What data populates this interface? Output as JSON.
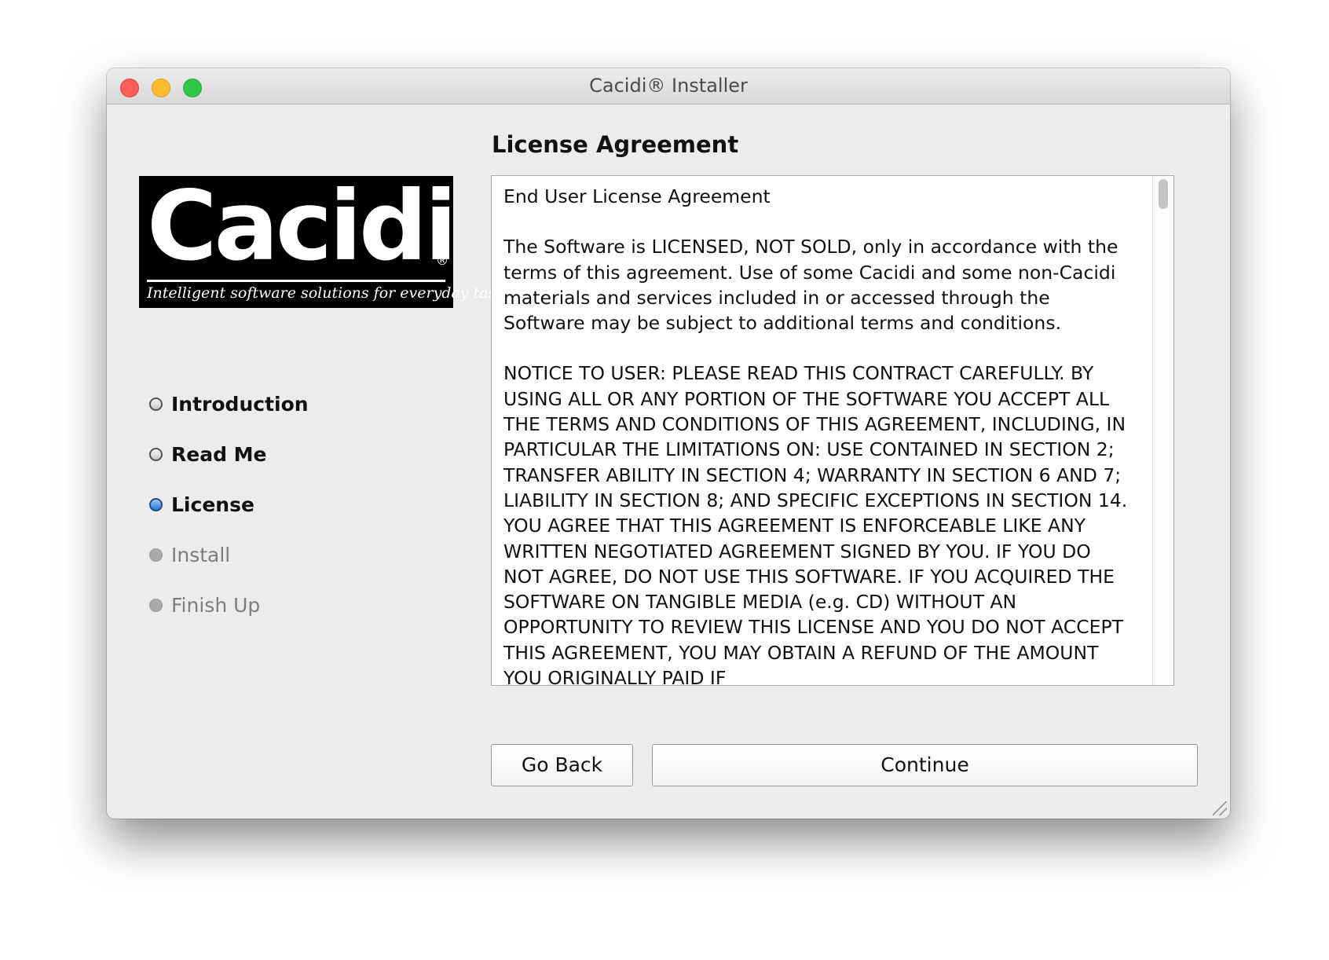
{
  "window": {
    "title": "Cacidi® Installer"
  },
  "logo": {
    "wordmark": "Cacidi",
    "registered_mark": "®",
    "tagline": "Intelligent software solutions for everyday tasks"
  },
  "steps": [
    {
      "label": "Introduction",
      "state": "done"
    },
    {
      "label": "Read Me",
      "state": "done"
    },
    {
      "label": "License",
      "state": "current"
    },
    {
      "label": "Install",
      "state": "pending"
    },
    {
      "label": "Finish Up",
      "state": "pending"
    }
  ],
  "main": {
    "heading": "License Agreement",
    "license_paragraphs": [
      "End User License Agreement",
      "The Software is LICENSED, NOT SOLD, only in accordance with the terms of this agreement. Use of some Cacidi and some non-Cacidi materials and services included in or accessed through the Software may be subject to additional terms and conditions.",
      "NOTICE TO USER: PLEASE READ THIS CONTRACT CAREFULLY. BY USING ALL OR ANY PORTION OF THE SOFTWARE YOU ACCEPT ALL THE TERMS AND CONDITIONS OF THIS AGREEMENT, INCLUDING, IN PARTICULAR THE LIMITATIONS ON: USE CONTAINED IN SECTION 2; TRANSFER ABILITY IN SECTION 4; WARRANTY IN SECTION 6 AND 7; LIABILITY IN SECTION 8; AND SPECIFIC EXCEPTIONS IN SECTION 14. YOU AGREE THAT THIS AGREEMENT IS ENFORCEABLE LIKE ANY WRITTEN NEGOTIATED AGREEMENT SIGNED BY YOU. IF YOU DO NOT AGREE, DO NOT USE THIS SOFTWARE. IF YOU ACQUIRED THE SOFTWARE ON TANGIBLE MEDIA (e.g. CD) WITHOUT AN OPPORTUNITY TO REVIEW THIS LICENSE AND YOU DO NOT ACCEPT THIS AGREEMENT, YOU MAY OBTAIN A REFUND OF THE AMOUNT YOU ORIGINALLY PAID IF"
    ]
  },
  "buttons": {
    "go_back": "Go Back",
    "continue": "Continue"
  }
}
